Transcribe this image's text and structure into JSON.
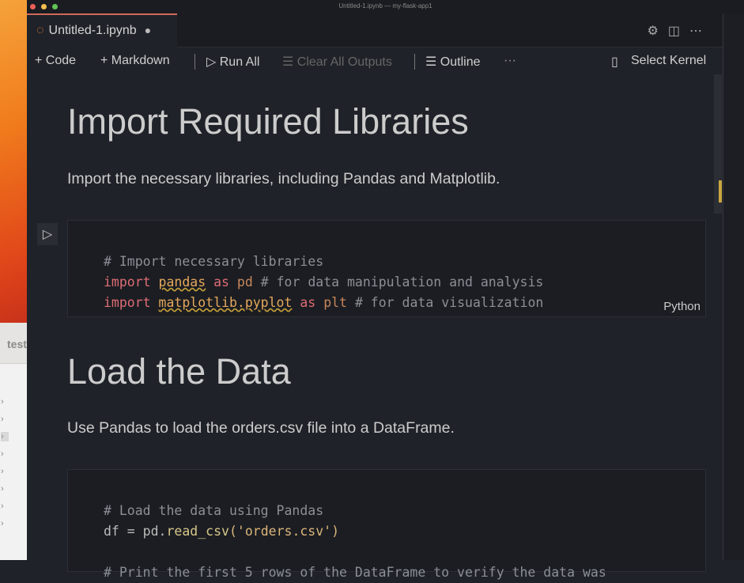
{
  "window": {
    "title": "Untitled-1.ipynb — my-flask-app1",
    "traffic_colors": [
      "#ec5f57",
      "#f5bd4f",
      "#61c454"
    ]
  },
  "finder": {
    "header": "test"
  },
  "tab": {
    "label": "Untitled-1.ipynb",
    "modified": "●"
  },
  "toolbar": {
    "code": "+ Code",
    "markdown": "+ Markdown",
    "run_all": "▷ Run All",
    "clear": "☰ Clear All Outputs",
    "outline": "☰ Outline",
    "more": "···",
    "kernel": "Select Kernel"
  },
  "cells": [
    {
      "heading": "Import Required Libraries",
      "text": "Import the necessary libraries, including Pandas and Matplotlib."
    },
    {
      "code_comment": "# Import necessary libraries",
      "line2": {
        "kw": "import",
        "mod": "pandas",
        "as": "as",
        "alias": "pd",
        "comment": "# for data manipulation and analysis"
      },
      "line3": {
        "kw": "import",
        "mod": "matplotlib.pyplot",
        "as": "as",
        "alias": "plt",
        "comment": "# for data visualization"
      },
      "language": "Python"
    },
    {
      "heading": "Load the Data",
      "text": "Use Pandas to load the orders.csv file into a DataFrame."
    },
    {
      "comment1": "# Load the data using Pandas",
      "line2a": "df = pd.",
      "fn": "read_csv",
      "open": "(",
      "str": "'orders.csv'",
      "close": ")",
      "comment2": "# Print the first 5 rows of the DataFrame to verify the data was"
    }
  ]
}
